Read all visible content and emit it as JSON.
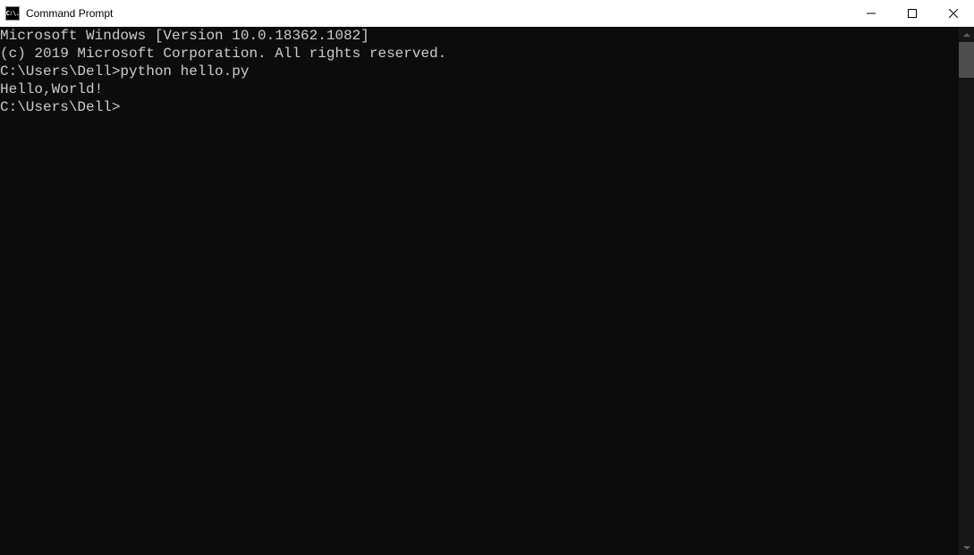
{
  "window": {
    "title": "Command Prompt",
    "icon_text": "C:\\."
  },
  "terminal": {
    "lines": [
      "Microsoft Windows [Version 10.0.18362.1082]",
      "(c) 2019 Microsoft Corporation. All rights reserved.",
      "",
      "C:\\Users\\Dell>python hello.py",
      "Hello,World!",
      "",
      "C:\\Users\\Dell>"
    ],
    "header_version": "Microsoft Windows [Version 10.0.18362.1082]",
    "header_copyright": "(c) 2019 Microsoft Corporation. All rights reserved.",
    "prompt1": "C:\\Users\\Dell>",
    "command1": "python hello.py",
    "output1": "Hello,World!",
    "prompt2": "C:\\Users\\Dell>"
  }
}
